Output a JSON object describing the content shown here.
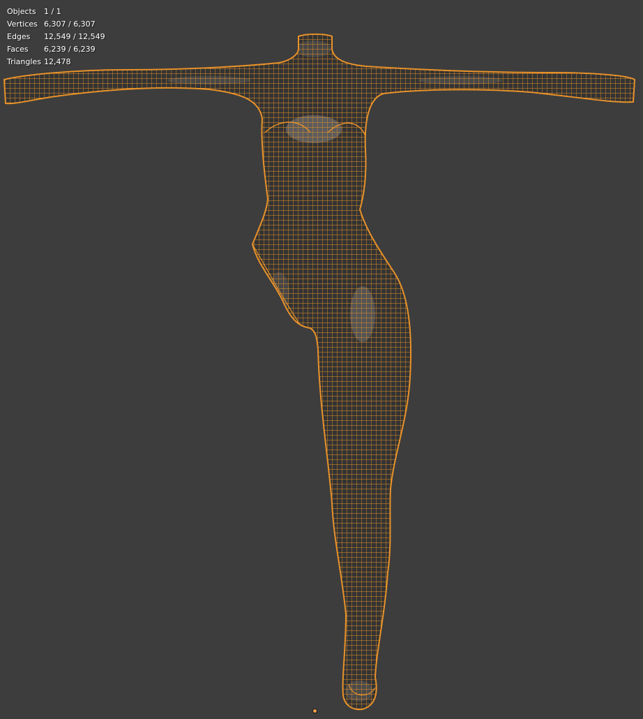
{
  "viewport": {
    "background": "#3d3d3d",
    "wire_color": "#e8922a",
    "mesh_fill": "#333333"
  },
  "stats": [
    {
      "label": "Objects",
      "value": "1 / 1"
    },
    {
      "label": "Vertices",
      "value": "6,307 / 6,307"
    },
    {
      "label": "Edges",
      "value": "12,549 / 12,549"
    },
    {
      "label": "Faces",
      "value": "6,239 / 6,239"
    },
    {
      "label": "Triangles",
      "value": "12,478"
    }
  ],
  "object": {
    "icon": "object-origin-icon",
    "mesh_icon": "wireframe-mesh-icon"
  }
}
